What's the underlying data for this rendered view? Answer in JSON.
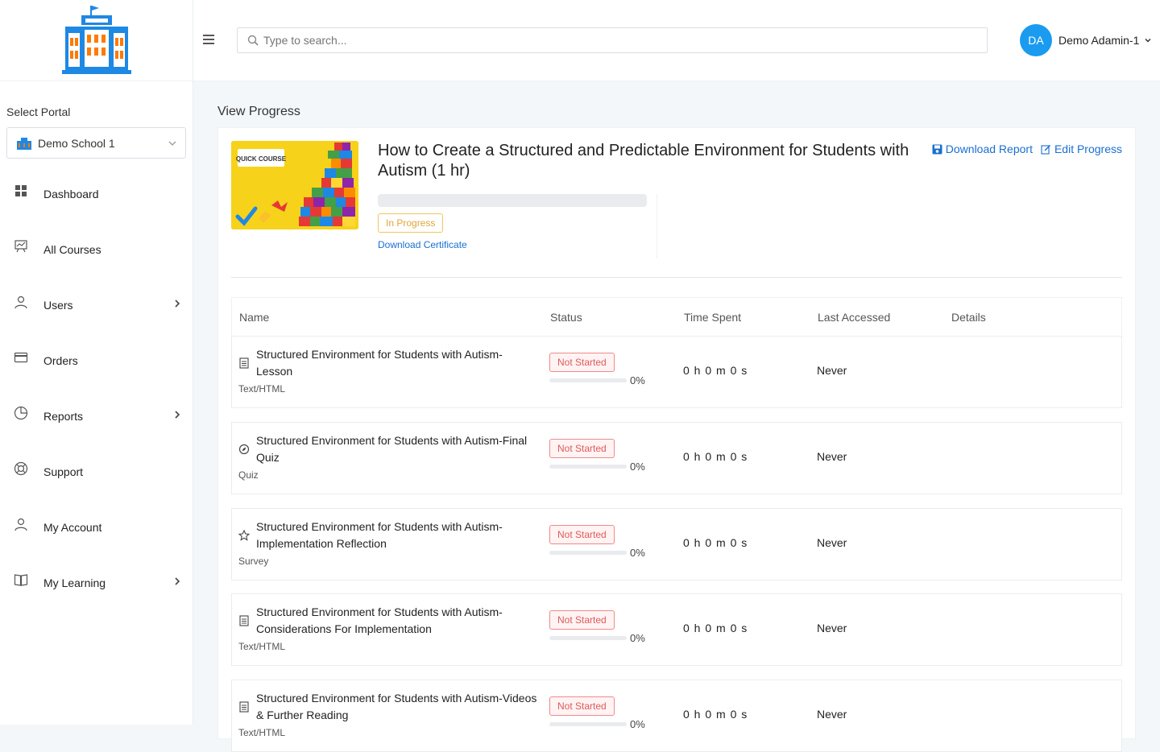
{
  "sidebar": {
    "portal_label": "Select Portal",
    "portal_value": "Demo School 1",
    "items": [
      {
        "label": "Dashboard",
        "icon": "grid-icon",
        "has_arrow": false
      },
      {
        "label": "All Courses",
        "icon": "chart-board-icon",
        "has_arrow": false
      },
      {
        "label": "Users",
        "icon": "user-icon",
        "has_arrow": true
      },
      {
        "label": "Orders",
        "icon": "card-icon",
        "has_arrow": false
      },
      {
        "label": "Reports",
        "icon": "pie-icon",
        "has_arrow": true
      },
      {
        "label": "Support",
        "icon": "lifebuoy-icon",
        "has_arrow": false
      },
      {
        "label": "My Account",
        "icon": "user-icon",
        "has_arrow": false
      },
      {
        "label": "My Learning",
        "icon": "book-icon",
        "has_arrow": true
      }
    ]
  },
  "header": {
    "search_placeholder": "Type to search...",
    "avatar_initials": "DA",
    "user_name": "Demo Adamin-1"
  },
  "main": {
    "page_title": "View Progress",
    "course": {
      "thumb_label": "QUICK COURSE",
      "title": "How to Create a Structured and Predictable Environment for Students with Autism (1 hr)",
      "download_report": "Download Report",
      "edit_progress": "Edit Progress",
      "status": "In Progress",
      "progress": 0,
      "certificate": "Download Certificate"
    },
    "table": {
      "headers": [
        "Name",
        "Status",
        "Time Spent",
        "Last Accessed",
        "Details"
      ],
      "rows": [
        {
          "name": "Structured Environment for Students with Autism-Lesson",
          "type": "Text/HTML",
          "icon": "document-icon",
          "status": "Not Started",
          "percent": "0%",
          "time": "0 h 0 m 0 s",
          "accessed": "Never"
        },
        {
          "name": "Structured Environment for Students with Autism-Final Quiz",
          "type": "Quiz",
          "icon": "compass-icon",
          "status": "Not Started",
          "percent": "0%",
          "time": "0 h 0 m 0 s",
          "accessed": "Never"
        },
        {
          "name": "Structured Environment for Students with Autism-Implementation Reflection",
          "type": "Survey",
          "icon": "star-icon",
          "status": "Not Started",
          "percent": "0%",
          "time": "0 h 0 m 0 s",
          "accessed": "Never"
        },
        {
          "name": "Structured Environment for Students with Autism-Considerations For Implementation",
          "type": "Text/HTML",
          "icon": "document-icon",
          "status": "Not Started",
          "percent": "0%",
          "time": "0 h 0 m 0 s",
          "accessed": "Never"
        },
        {
          "name": "Structured Environment for Students with Autism-Videos & Further Reading",
          "type": "Text/HTML",
          "icon": "document-icon",
          "status": "Not Started",
          "percent": "0%",
          "time": "0 h 0 m 0 s",
          "accessed": "Never"
        }
      ]
    }
  },
  "colors": {
    "accent": "#1a9bf0",
    "link": "#1a6fd1",
    "not_started": "#e05a5a",
    "in_progress": "#e2a53a"
  }
}
